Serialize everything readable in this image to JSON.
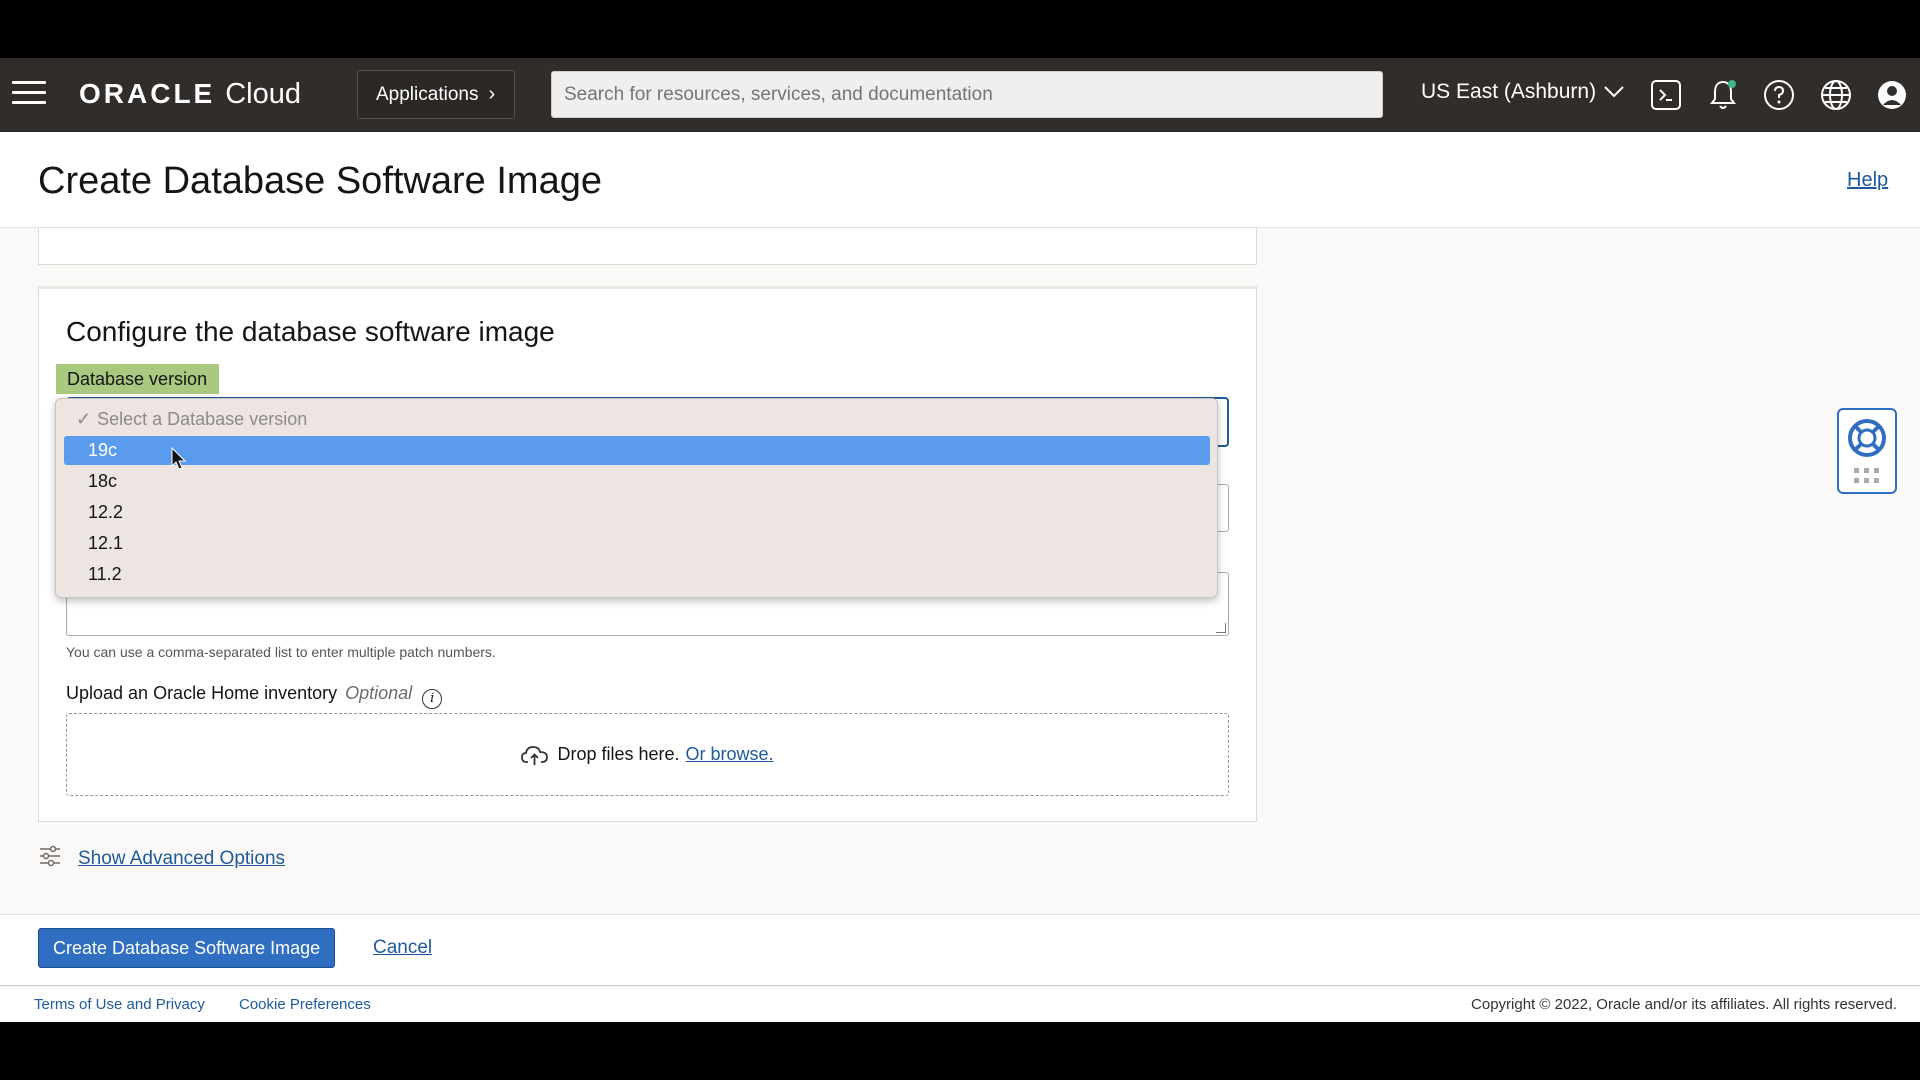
{
  "header": {
    "brand_oracle": "ORACLE",
    "brand_cloud": "Cloud",
    "applications_label": "Applications",
    "search_placeholder": "Search for resources, services, and documentation",
    "region_label": "US East (Ashburn)"
  },
  "page": {
    "title": "Create Database Software Image",
    "help_label": "Help"
  },
  "form": {
    "section_title": "Configure the database software image",
    "database_version_label": "Database version",
    "dropdown": {
      "placeholder": "Select a Database version",
      "options": [
        "19c",
        "18c",
        "12.2",
        "12.1",
        "11.2"
      ],
      "selected": "19c"
    },
    "patch_hint": "You can use a comma-separated list to enter multiple patch numbers.",
    "upload_label": "Upload an Oracle Home inventory",
    "upload_optional": "Optional",
    "dropzone_text": "Drop files here.",
    "dropzone_link": "Or browse."
  },
  "advanced_options_label": "Show Advanced Options",
  "actions": {
    "create_label": "Create Database Software Image",
    "cancel_label": "Cancel"
  },
  "footer": {
    "terms_label": "Terms of Use and Privacy",
    "cookie_label": "Cookie Preferences",
    "copyright": "Copyright © 2022, Oracle and/or its affiliates. All rights reserved."
  },
  "colors": {
    "header_bg": "#312d2a",
    "accent": "#2f6ec1",
    "selected_option": "#5b9bee",
    "label_highlight": "#a8c97f"
  }
}
